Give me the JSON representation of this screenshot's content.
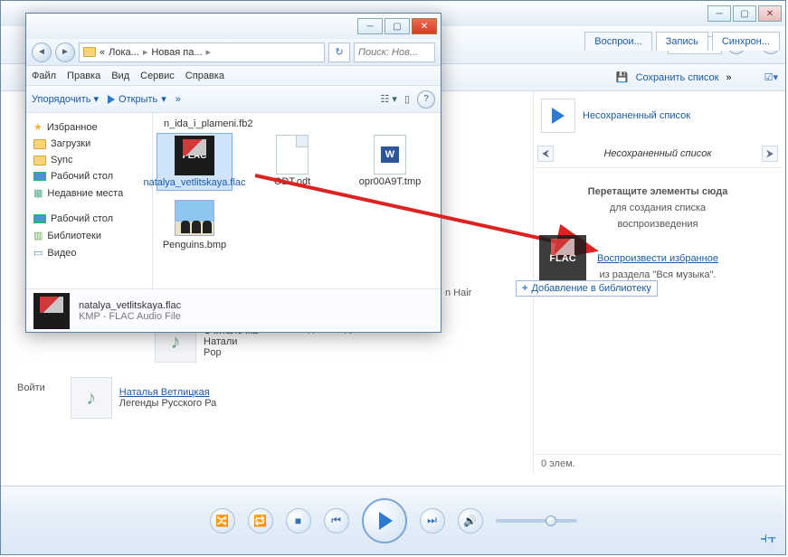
{
  "wmp": {
    "tabs": [
      "Воспрои...",
      "Запись",
      "Синхрон..."
    ],
    "toolbar": {
      "save_list": "Сохранить список",
      "chev": "»"
    },
    "playlist": {
      "unsaved_link": "Несохраненный список",
      "header": "Несохраненный список",
      "drop_big": "Перетащите элементы сюда",
      "drop_sub1": "для создания списка",
      "drop_sub2": "воспроизведения",
      "add_lib": "Добавление в библиотеку",
      "fav_link": "Воспроизвести избранное",
      "fav_sub": "из раздела \"Вся музыка\".",
      "footer": "0 элем."
    },
    "library": {
      "login": "Войти",
      "track1": {
        "t": "Считалочка",
        "artist": "Натали",
        "genre": "Pop"
      },
      "col2": "Новогодние Игрушки",
      "artist_link": "Наталья Ветлицкая",
      "track2": "Легенды Русского Ра"
    },
    "nhair": "n Hair"
  },
  "explorer": {
    "crumb": {
      "a": "Лока...",
      "b": "Новая па..."
    },
    "search_ph": "Поиск: Нов...",
    "menu": [
      "Файл",
      "Правка",
      "Вид",
      "Сервис",
      "Справка"
    ],
    "tool": {
      "organize": "Упорядочить",
      "open": "Открыть",
      "chev": "»"
    },
    "nav": {
      "fav": "Избранное",
      "downloads": "Загрузки",
      "sync": "Sync",
      "desktop": "Рабочий стол",
      "recent": "Недавние места",
      "desktop2": "Рабочий стол",
      "libraries": "Библиотеки",
      "video": "Видео"
    },
    "files": {
      "f0": "n_ida_i_plameni.fb2",
      "f1": "natalya_vetlitskaya.flac",
      "f2": "ODT.odt",
      "f3": "opr00A9T.tmp",
      "f4": "Penguins.bmp"
    },
    "status": {
      "name": "natalya_vetlitskaya.flac",
      "type": "KMP - FLAC Audio File"
    }
  },
  "drag": {
    "add_lib": "Добавление в библиотеку"
  }
}
